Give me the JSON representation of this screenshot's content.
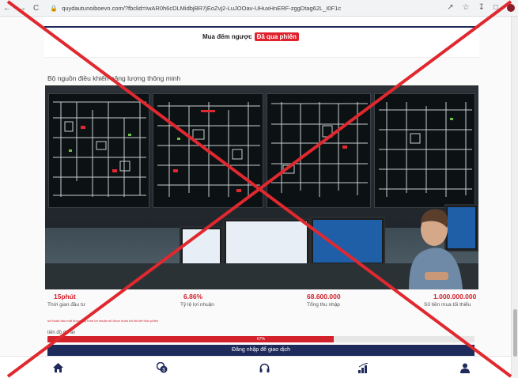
{
  "browser": {
    "url": "quydautunoiboevn.com/?fbclid=IwAR0h6cDLMidbjBR7jEoZvj2-LuJOOav-UHuxHnERF-zggDtag62L_I0F1c",
    "nav_back": "←",
    "nav_forward": "→",
    "nav_reload": "C"
  },
  "countdown": {
    "label": "Mua đếm ngược",
    "badge": "Đã qua phiên"
  },
  "product": {
    "title": "Bộ nguồn điều khiển năng lượng thông minh"
  },
  "stats": [
    {
      "value": "15phút",
      "label": "Thời gian đầu tư"
    },
    {
      "value": "6.86%",
      "label": "Tỷ lệ lợi nhuận"
    },
    {
      "value": "68.600.000",
      "label": "Tổng thu nhập"
    },
    {
      "value": "1.000.000.000",
      "label": "Số tiền mua tối thiểu"
    }
  ],
  "note": "số thuần bảo mật được quy trình lợi nhuận sẽ được hoàn trả khi kết thúc phiên",
  "progress": {
    "label": "tiến độ dự án",
    "value": 0.67,
    "text": "67%"
  },
  "login_button": "Đăng nhập để giao dịch",
  "bottom_nav": [
    {
      "icon": "home-icon"
    },
    {
      "icon": "coins-icon"
    },
    {
      "icon": "headset-icon"
    },
    {
      "icon": "chart-icon"
    },
    {
      "icon": "user-icon"
    }
  ],
  "colors": {
    "accent_red": "#d3222b",
    "navy": "#1e2a5a",
    "watermark_cross": "#e0282f"
  }
}
